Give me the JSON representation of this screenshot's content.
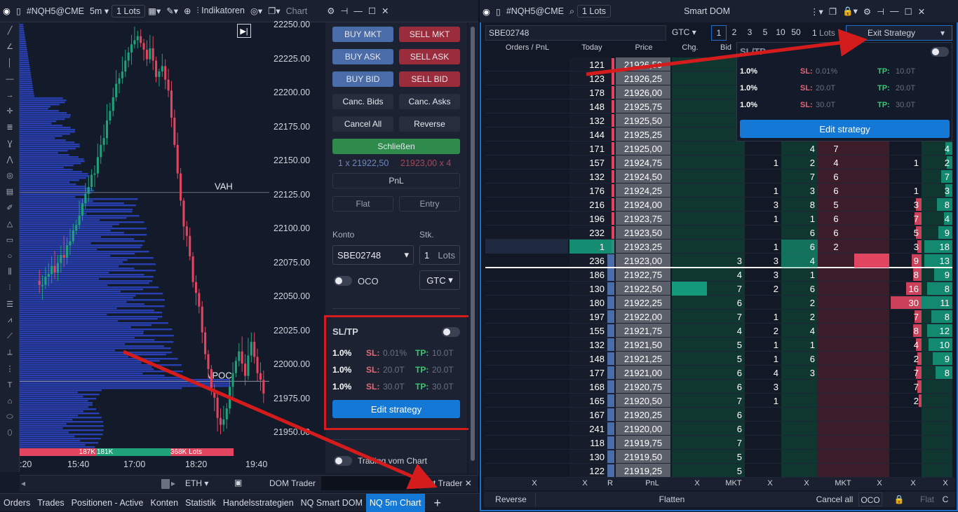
{
  "left_toolbar": {
    "symbol": "#NQH5@CME",
    "timeframe": "5m",
    "lots": "1",
    "lots_label": "Lots",
    "indicators": "Indikatoren",
    "chart_label": "Chart"
  },
  "price_axis": [
    "22250.00",
    "22225.00",
    "22200.00",
    "22175.00",
    "22150.00",
    "22125.00",
    "22100.00",
    "22075.00",
    "22050.00",
    "22025.00",
    "22000.00",
    "21975.00",
    "21950.00"
  ],
  "time_axis": [
    ":20",
    "15:40",
    "17:00",
    "18:20",
    "19:40"
  ],
  "chart_labels": {
    "vah": "VAH",
    "vpoc": "vPOC",
    "volume_bar": [
      "187K",
      "181K",
      "368K Lots"
    ]
  },
  "candles": [
    [
      22064,
      22061,
      22072,
      22055
    ],
    [
      22060,
      22061,
      22068,
      22050
    ],
    [
      22061,
      22067,
      22074,
      22058
    ],
    [
      22067,
      22069,
      22077,
      22060
    ],
    [
      22069,
      22075,
      22082,
      22062
    ],
    [
      22075,
      22070,
      22086,
      22065
    ],
    [
      22070,
      22077,
      22083,
      22064
    ],
    [
      22077,
      22083,
      22090,
      22070
    ],
    [
      22083,
      22081,
      22097,
      22074
    ],
    [
      22081,
      22090,
      22096,
      22076
    ],
    [
      22090,
      22093,
      22102,
      22083
    ],
    [
      22093,
      22101,
      22106,
      22091
    ],
    [
      22101,
      22105,
      22109,
      22098
    ],
    [
      22105,
      22112,
      22123,
      22102
    ],
    [
      22112,
      22121,
      22124,
      22108
    ],
    [
      22121,
      22128,
      22136,
      22117
    ],
    [
      22128,
      22133,
      22141,
      22122
    ],
    [
      22133,
      22142,
      22146,
      22130
    ],
    [
      22142,
      22143,
      22149,
      22133
    ],
    [
      22143,
      22155,
      22165,
      22140
    ],
    [
      22155,
      22164,
      22171,
      22150
    ],
    [
      22164,
      22169,
      22179,
      22159
    ],
    [
      22169,
      22182,
      22194,
      22164
    ],
    [
      22182,
      22189,
      22195,
      22179
    ],
    [
      22189,
      22199,
      22206,
      22185
    ],
    [
      22199,
      22209,
      22219,
      22196
    ],
    [
      22209,
      22213,
      22217,
      22202
    ],
    [
      22213,
      22218,
      22229,
      22209
    ],
    [
      22218,
      22226,
      22234,
      22214
    ],
    [
      22226,
      22232,
      22236,
      22221
    ],
    [
      22232,
      22238,
      22245,
      22223
    ],
    [
      22238,
      22241,
      22251,
      22235
    ],
    [
      22241,
      22244,
      22248,
      22235
    ],
    [
      22244,
      22239,
      22249,
      22236
    ],
    [
      22239,
      22234,
      22242,
      22226
    ],
    [
      22234,
      22227,
      22241,
      22222
    ],
    [
      22227,
      22235,
      22245,
      22224
    ],
    [
      22235,
      22226,
      22244,
      22219
    ],
    [
      22226,
      22214,
      22229,
      22210
    ],
    [
      22214,
      22218,
      22220,
      22207
    ],
    [
      22218,
      22222,
      22231,
      22214
    ],
    [
      22222,
      22212,
      22227,
      22205
    ],
    [
      22212,
      22204,
      22220,
      22199
    ],
    [
      22204,
      22184,
      22211,
      22177
    ],
    [
      22184,
      22164,
      22190,
      22162
    ],
    [
      22164,
      22143,
      22173,
      22139
    ],
    [
      22143,
      22123,
      22147,
      22119
    ],
    [
      22123,
      22104,
      22125,
      22094
    ],
    [
      22104,
      22097,
      22108,
      22089
    ],
    [
      22097,
      22082,
      22103,
      22079
    ],
    [
      22082,
      22063,
      22085,
      22059
    ],
    [
      22063,
      22055,
      22068,
      22046
    ],
    [
      22055,
      22045,
      22058,
      22040
    ],
    [
      22045,
      22026,
      22049,
      22018
    ],
    [
      22026,
      22010,
      22030,
      22006
    ],
    [
      22010,
      21999,
      22013,
      21992
    ],
    [
      21999,
      21984,
      22002,
      21980
    ],
    [
      21984,
      21978,
      21988,
      21968
    ],
    [
      21978,
      21963,
      21981,
      21953
    ],
    [
      21963,
      21958,
      21970,
      21951
    ],
    [
      21958,
      21962,
      21972,
      21953
    ],
    [
      21962,
      21970,
      21974,
      21955
    ],
    [
      21970,
      21986,
      21991,
      21966
    ],
    [
      21986,
      21996,
      22004,
      21978
    ],
    [
      21996,
      22005,
      22008,
      21993
    ],
    [
      22005,
      22012,
      22018,
      22001
    ],
    [
      22012,
      22003,
      22023,
      21997
    ],
    [
      22003,
      21994,
      22010,
      21987
    ],
    [
      21994,
      22009,
      22022,
      21991
    ],
    [
      22009,
      22019,
      22026,
      22004
    ],
    [
      22019,
      22008,
      22026,
      22003
    ],
    [
      22008,
      21996,
      22014,
      21990
    ],
    [
      21996,
      21991,
      22004,
      21983
    ],
    [
      21991,
      21981,
      21998,
      21974
    ]
  ],
  "trader": {
    "buy_mkt": "BUY MKT",
    "sell_mkt": "SELL MKT",
    "buy_ask": "BUY ASK",
    "sell_ask": "SELL ASK",
    "buy_bid": "BUY BID",
    "sell_bid": "SELL BID",
    "canc_bids": "Canc. Bids",
    "canc_asks": "Canc. Asks",
    "cancel_all": "Cancel All",
    "reverse": "Reverse",
    "close": "Schließen",
    "bid_quote": "1 x 21922,50",
    "ask_quote": "21923,00 x 4",
    "pnl": "PnL",
    "flat": "Flat",
    "entry": "Entry",
    "konto_label": "Konto",
    "account": "SBE02748",
    "stk_label": "Stk.",
    "stk_value": "1",
    "lots": "Lots",
    "oco": "OCO",
    "gtc": "GTC",
    "sltp_title": "SL/TP",
    "edit_strategy": "Edit strategy",
    "trading_from_chart": "Trading vom Chart"
  },
  "sltp_rows": [
    {
      "pct": "1.0%",
      "sl_l": "SL:",
      "sl": "0.01%",
      "tp_l": "TP:",
      "tp": "10.0T"
    },
    {
      "pct": "1.0%",
      "sl_l": "SL:",
      "sl": "20.0T",
      "tp_l": "TP:",
      "tp": "20.0T"
    },
    {
      "pct": "1.0%",
      "sl_l": "SL:",
      "sl": "30.0T",
      "tp_l": "TP:",
      "tp": "30.0T"
    }
  ],
  "left_bottom": {
    "eth": "ETH",
    "dom_trader": "DOM Trader",
    "chart_trader": "Chart Trader"
  },
  "tabs": [
    "Orders",
    "Trades",
    "Positionen - Active",
    "Konten",
    "Statistik",
    "Handelsstrategien",
    "NQ Smart DOM",
    "NQ 5m Chart"
  ],
  "dom_title": {
    "symbol": "#NQH5@CME",
    "lots": "1",
    "lots_label": "Lots",
    "title": "Smart DOM"
  },
  "dom_toolbar": {
    "account": "SBE02748",
    "tif": "GTC",
    "qty": [
      "1",
      "2",
      "3",
      "5",
      "10",
      "50"
    ],
    "lots_qty": "1",
    "lots_label": "Lots",
    "exit": "Exit Strategy"
  },
  "dom_headers": [
    "Orders / PnL",
    "Today",
    "Price",
    "Chg.",
    "Bid"
  ],
  "dom_rows": [
    {
      "today": "121",
      "price": "21926,50",
      "bid": "",
      "c1": "",
      "c2": "",
      "c3": "",
      "c4": "",
      "c5": ""
    },
    {
      "today": "123",
      "price": "21926,25",
      "bid": "",
      "c1": "",
      "c2": "",
      "c3": "",
      "c4": "",
      "c5": ""
    },
    {
      "today": "178",
      "price": "21926,00",
      "bid": "",
      "c1": "",
      "c2": "",
      "c3": "",
      "c4": "",
      "c5": ""
    },
    {
      "today": "148",
      "price": "21925,75",
      "bid": "",
      "c1": "",
      "c2": "",
      "c3": "",
      "c4": "",
      "c5": ""
    },
    {
      "today": "132",
      "price": "21925,50",
      "bid": "",
      "c1": "",
      "c2": "",
      "c3": "",
      "c4": "",
      "c5": ""
    },
    {
      "today": "144",
      "price": "21925,25",
      "bid": "",
      "c1": "",
      "c2": "",
      "c3": "",
      "c4": "",
      "c5": ""
    },
    {
      "today": "171",
      "price": "21925,00",
      "bid": "",
      "c1": "",
      "c2": "4",
      "c3": "7",
      "c4": "",
      "c5": "4"
    },
    {
      "today": "157",
      "price": "21924,75",
      "bid": "",
      "c1": "1",
      "c2": "2",
      "c3": "4",
      "c4": "1",
      "c5": "2"
    },
    {
      "today": "132",
      "price": "21924,50",
      "bid": "",
      "c1": "",
      "c2": "7",
      "c3": "6",
      "c4": "",
      "c5": "7"
    },
    {
      "today": "176",
      "price": "21924,25",
      "bid": "",
      "c1": "1",
      "c2": "3",
      "c3": "6",
      "c4": "1",
      "c5": "3"
    },
    {
      "today": "216",
      "price": "21924,00",
      "bid": "",
      "c1": "3",
      "c2": "8",
      "c3": "5",
      "c4": "3",
      "c5": "8"
    },
    {
      "today": "196",
      "price": "21923,75",
      "bid": "",
      "c1": "1",
      "c2": "1",
      "c3": "6",
      "c4": "7",
      "c5": "4"
    },
    {
      "today": "232",
      "price": "21923,50",
      "bid": "",
      "c1": "",
      "c2": "6",
      "c3": "6",
      "c4": "5",
      "c5": "9"
    },
    {
      "today": "1",
      "price": "21923,25",
      "bid": "",
      "c1": "1",
      "c2": "6",
      "c3": "2",
      "c4": "3",
      "c5": "18"
    },
    {
      "today": "236",
      "price": "21923,00",
      "bid": "3",
      "c1": "3",
      "c2": "4",
      "c3": "",
      "c4": "9",
      "c5": "13"
    },
    {
      "today": "186",
      "price": "21922,75",
      "bid": "4",
      "c1": "3",
      "c2": "1",
      "c3": "",
      "c4": "8",
      "c5": "9"
    },
    {
      "today": "130",
      "price": "21922,50",
      "bid": "7",
      "c1": "2",
      "c2": "6",
      "c3": "",
      "c4": "16",
      "c5": "8"
    },
    {
      "today": "180",
      "price": "21922,25",
      "bid": "6",
      "c1": "",
      "c2": "2",
      "c3": "",
      "c4": "30",
      "c5": "11"
    },
    {
      "today": "197",
      "price": "21922,00",
      "bid": "7",
      "c1": "1",
      "c2": "2",
      "c3": "",
      "c4": "7",
      "c5": "8"
    },
    {
      "today": "155",
      "price": "21921,75",
      "bid": "4",
      "c1": "2",
      "c2": "4",
      "c3": "",
      "c4": "8",
      "c5": "12"
    },
    {
      "today": "132",
      "price": "21921,50",
      "bid": "5",
      "c1": "1",
      "c2": "1",
      "c3": "",
      "c4": "4",
      "c5": "10"
    },
    {
      "today": "148",
      "price": "21921,25",
      "bid": "5",
      "c1": "1",
      "c2": "6",
      "c3": "",
      "c4": "2",
      "c5": "9"
    },
    {
      "today": "177",
      "price": "21921,00",
      "bid": "6",
      "c1": "4",
      "c2": "3",
      "c3": "",
      "c4": "7",
      "c5": "8"
    },
    {
      "today": "168",
      "price": "21920,75",
      "bid": "6",
      "c1": "3",
      "c2": "",
      "c3": "",
      "c4": "7",
      "c5": ""
    },
    {
      "today": "165",
      "price": "21920,50",
      "bid": "7",
      "c1": "1",
      "c2": "",
      "c3": "",
      "c4": "2",
      "c5": ""
    },
    {
      "today": "167",
      "price": "21920,25",
      "bid": "6",
      "c1": "",
      "c2": "",
      "c3": "",
      "c4": "",
      "c5": ""
    },
    {
      "today": "241",
      "price": "21920,00",
      "bid": "6",
      "c1": "",
      "c2": "",
      "c3": "",
      "c4": "",
      "c5": ""
    },
    {
      "today": "118",
      "price": "21919,75",
      "bid": "7",
      "c1": "",
      "c2": "",
      "c3": "",
      "c4": "",
      "c5": ""
    },
    {
      "today": "130",
      "price": "21919,50",
      "bid": "5",
      "c1": "",
      "c2": "",
      "c3": "",
      "c4": "",
      "c5": ""
    },
    {
      "today": "122",
      "price": "21919,25",
      "bid": "5",
      "c1": "",
      "c2": "",
      "c3": "",
      "c4": "",
      "c5": ""
    }
  ],
  "dom_footer1": [
    "X",
    "X",
    "R",
    "PnL",
    "X",
    "MKT",
    "X",
    "X",
    "MKT",
    "X",
    "X",
    "X"
  ],
  "dom_footer2": {
    "reverse": "Reverse",
    "flatten": "Flatten",
    "cancel_all": "Cancel all",
    "oco": "OCO",
    "flat": "Flat",
    "c": "C"
  },
  "dom_sltp_title": "SL/TP",
  "colors": {
    "buy": "#4a6ca8",
    "sell": "#9b2c3c",
    "accent": "#1479d6",
    "candle_up": "#1fa27a",
    "candle_down": "#e2455f",
    "profile": "#2b46c9"
  }
}
